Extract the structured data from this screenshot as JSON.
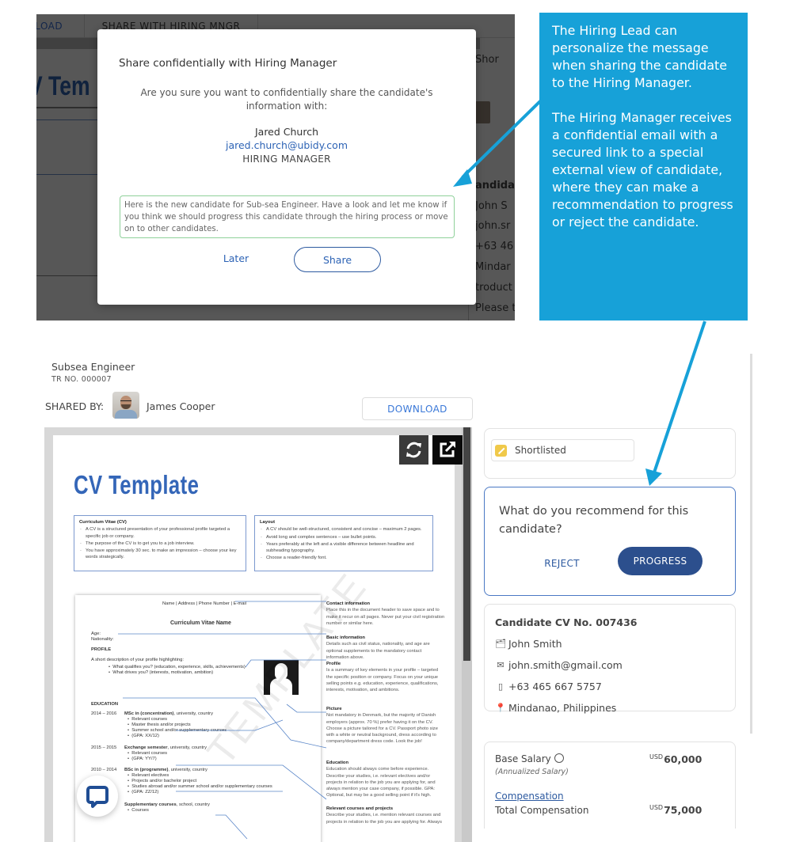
{
  "top_screenshot": {
    "toolbar": {
      "download_partial": "VNLOAD",
      "share_tab": "SHARE WITH HIRING MNGR"
    },
    "background_cv_title": "V Tem",
    "background_right": {
      "status_partial": "Shor",
      "candidate_partial": "andidat",
      "name_partial": "John S",
      "email_partial": "john.sr",
      "phone_partial": "+63 46",
      "location_partial": "Mindar",
      "intro_partial": "troduct",
      "please_partial": "Please to"
    },
    "modal": {
      "title": "Share confidentially with Hiring Manager",
      "question": "Are you sure you want to confidentially share the candidate's information with:",
      "recipient_name": "Jared Church",
      "recipient_email": "jared.church@ubidy.com",
      "recipient_role": "HIRING MANAGER",
      "message": "Here is the new candidate for Sub-sea Engineer. Have a look and let me know if you think we should progress this candidate through the hiring process or move on to other candidates.",
      "later_label": "Later",
      "share_label": "Share"
    }
  },
  "callout": {
    "paragraph1": "The Hiring Lead can personalize the message when sharing the candidate to the Hiring Manager.",
    "paragraph2": "The Hiring Manager receives a confidential email with a secured link to a special external view of candidate, where they can make a recommendation to progress or reject the candidate.",
    "color": "#17a1d8"
  },
  "bottom_screenshot": {
    "job_title": "Subsea Engineer",
    "tr_no": "TR NO. 000007",
    "shared_by_label": "SHARED BY:",
    "shared_by_name": "James Cooper",
    "download_label": "DOWNLOAD",
    "cv_document": {
      "title": "CV Template",
      "box_left": {
        "title": "Curriculum Vitae (CV)",
        "items": [
          "A CV is a structured presentation of your professional profile targeted a specific job or company.",
          "The purpose of the CV is to get you to a job interview.",
          "You have approximately 30 sec. to make an impression – choose your key words strategically."
        ]
      },
      "box_right": {
        "title": "Layout",
        "items": [
          "A CV should be well-structured, consistent and concise – maximum 2 pages.",
          "Avoid long and complex sentences – use bullet points.",
          "Years preferably at the left and a visible difference between headline and subheading typography.",
          "Choose a reader-friendly font."
        ]
      },
      "sample": {
        "header": "Name | Address | Phone Number | E-mail",
        "name": "Curriculum Vitae Name",
        "age": "Age:",
        "nationality": "Nationality:",
        "profile_heading": "PROFILE",
        "profile_intro": "A short description of your profile highlighting:",
        "profile_bullets": [
          "What qualifies you? (education, experience, skills, achievements)",
          "What drives you? (interests, motivation, ambition)"
        ],
        "education_heading": "EDUCATION",
        "education": [
          {
            "years": "2014 – 2016",
            "title": "MSc in (concentration)",
            "rest": ", university, country",
            "bullets": [
              "Relevant courses",
              "Master thesis and/or projects",
              "Summer school and/or supplementary courses",
              "(GPA: XX/12)"
            ]
          },
          {
            "years": "2015 – 2015",
            "title": "Exchange semester",
            "rest": ", university, country",
            "bullets": [
              "Relevant courses",
              "(GPA: YY/7)"
            ]
          },
          {
            "years": "2010 – 2014",
            "title": "BSc in (programme)",
            "rest": ", university, country",
            "bullets": [
              "Relevant electives",
              "Projects and/or bachelor project",
              "Studies abroad and/or summer school and/or supplementary courses",
              "(GPA: ZZ/12)"
            ]
          },
          {
            "years": "",
            "title": "Supplementary courses",
            "rest": ", school, country",
            "bullets": [
              "Courses"
            ]
          }
        ],
        "watermark": "TEMPLATE"
      },
      "annotations": [
        {
          "title": "Contact information",
          "text": "Place this in the document header to save space and to make it recur on all pages. Never put your civil registration number or similar here."
        },
        {
          "title": "Basic information",
          "text": "Details such as civil status, nationality, and age are optional supplements to the mandatory contact information above."
        },
        {
          "title": "Profile",
          "text": "Is a summary of key elements in your profile – targeted the specific position or company. Focus on your unique selling points e.g. education, experience, qualifications, interests, motivation, and ambitions."
        },
        {
          "title": "Picture",
          "text": "Not mandatory in Denmark, but the majority of Danish employers (approx. 70 %) prefer having it on the CV. Choose a picture tailored for a CV. Passport photo size with a white or neutral background, dress according to company/department dress code. Look the job!"
        },
        {
          "title": "Education",
          "text": "Education should always come before experience. Describe your studies, i.e. relevant electives and/or projects in relation to the job you are applying for, and always mention your case company, if possible. GPA: Optional, but may be a good selling point if it's high."
        },
        {
          "title": "Relevant courses and projects",
          "text": "Describe your studies, i.e. mention relevant courses and projects in relation to the job you are applying for. Always"
        }
      ]
    },
    "status": {
      "label": "Shortlisted",
      "color": "#f0c94a"
    },
    "recommend": {
      "question": "What do you recommend for this candidate?",
      "reject_label": "REJECT",
      "progress_label": "PROGRESS",
      "progress_color": "#2c4f8d"
    },
    "candidate": {
      "title": "Candidate CV No. 007436",
      "name": "John Smith",
      "email": "john.smith@gmail.com",
      "phone": "+63 465 667 5757",
      "location": "Mindanao, Philippines"
    },
    "salary": {
      "base_label": "Base Salary",
      "base_sub": "(Annualized Salary)",
      "base_currency": "USD",
      "base_value": "60,000",
      "comp_link": "Compensation",
      "total_label": "Total Compensation",
      "total_currency": "USD",
      "total_value": "75,000"
    }
  }
}
